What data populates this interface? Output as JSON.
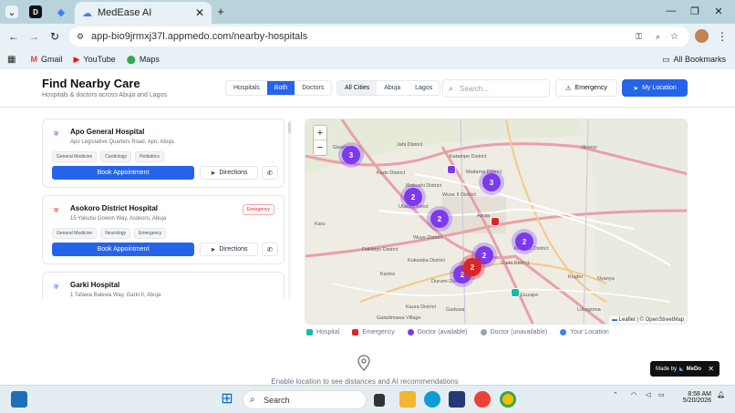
{
  "browser": {
    "tab_title": "MedEase AI",
    "url": "app-bio9jrmxj37l.appmedo.com/nearby-hospitals",
    "bookmarks": [
      "Gmail",
      "YouTube",
      "Maps"
    ],
    "all_bookmarks": "All Bookmarks"
  },
  "header": {
    "title": "Find Nearby Care",
    "subtitle": "Hospitals & doctors across Abuja and Lagos",
    "type_filters": [
      "Hospitals",
      "Both",
      "Doctors"
    ],
    "type_selected": "Both",
    "city_filters": [
      "All Cities",
      "Abuja",
      "Lagos"
    ],
    "city_selected": "All Cities",
    "search_placeholder": "Search...",
    "emergency_label": "Emergency",
    "my_location_label": "My Location"
  },
  "cards": [
    {
      "name": "Apo General Hospital",
      "address": "Apo Legislative Quarters Road, Apo, Abuja",
      "tags": [
        "General Medicine",
        "Cardiology",
        "Pediatrics"
      ],
      "emergency": false
    },
    {
      "name": "Asokoro District Hospital",
      "address": "15 Yakubu Gowon Way, Asokoro, Abuja",
      "tags": [
        "General Medicine",
        "Neurology",
        "Emergency"
      ],
      "emergency": true
    },
    {
      "name": "Garki Hospital",
      "address": "1 Tafawa Balewa Way, Garki II, Abuja",
      "tags": [],
      "emergency": false
    }
  ],
  "card_actions": {
    "book": "Book Appointment",
    "directions": "Directions",
    "emergency_badge": "Emergency"
  },
  "map": {
    "labels": [
      "Gwarinpa",
      "Jahi District",
      "Katampe District",
      "Jikwoyi",
      "Kado District",
      "Mabushi District",
      "Maitama District",
      "Utako District",
      "Wuse II District",
      "Karu",
      "Abuja",
      "Wuye District",
      "Dakibiyu District",
      "Asokoro District",
      "Kukwaba District",
      "Garki District",
      "Karmo",
      "Durumi District",
      "Kugbo",
      "Nyanya",
      "Guzape",
      "Kaura District",
      "Gaduwa",
      "Galadimawa Village",
      "Lokogoma"
    ],
    "clusters": [
      {
        "count": "3",
        "kind": "doctor"
      },
      {
        "count": "3",
        "kind": "doctor"
      },
      {
        "count": "2",
        "kind": "doctor"
      },
      {
        "count": "2",
        "kind": "doctor"
      },
      {
        "count": "2",
        "kind": "doctor"
      },
      {
        "count": "2",
        "kind": "doctor"
      },
      {
        "count": "2",
        "kind": "doctor"
      },
      {
        "count": "2",
        "kind": "emergency"
      }
    ],
    "attribution": "Leaflet | © OpenStreetMap"
  },
  "legend": [
    {
      "label": "Hospital",
      "color": "#14b8a6"
    },
    {
      "label": "Emergency",
      "color": "#dc2626"
    },
    {
      "label": "Doctor (available)",
      "color": "#7c3aed"
    },
    {
      "label": "Doctor (unavailable)",
      "color": "#9ca3af"
    },
    {
      "label": "Your Location",
      "color": "#3b82f6"
    }
  ],
  "enable_text": "Enable location to see distances and AI recommendations",
  "made_by": "Made by",
  "made_by_brand": "MeDo",
  "taskbar": {
    "search": "Search",
    "time": "8:58 AM",
    "date": "5/20/2026"
  }
}
